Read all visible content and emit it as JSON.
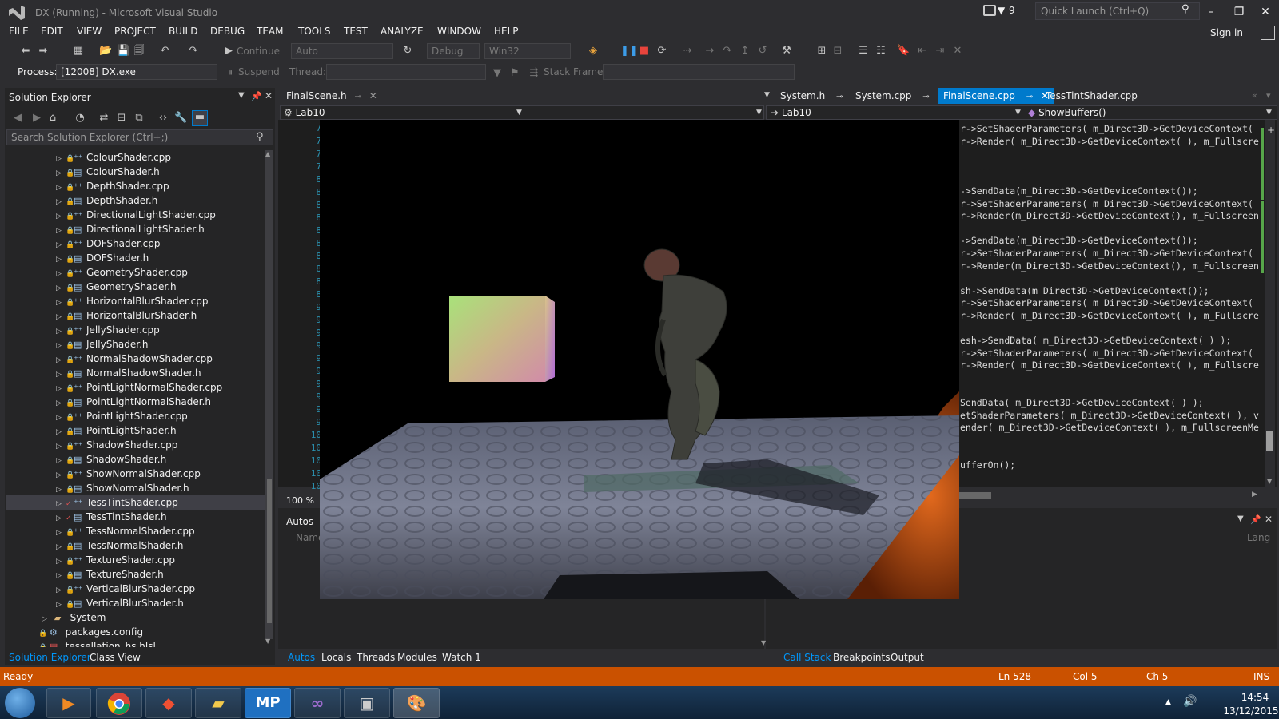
{
  "window": {
    "title": "DX (Running) - Microsoft Visual Studio",
    "notification_count": "9",
    "quick_launch_placeholder": "Quick Launch (Ctrl+Q)",
    "sign_in": "Sign in"
  },
  "menu": [
    "FILE",
    "EDIT",
    "VIEW",
    "PROJECT",
    "BUILD",
    "DEBUG",
    "TEAM",
    "TOOLS",
    "TEST",
    "ANALYZE",
    "WINDOW",
    "HELP"
  ],
  "toolbar": {
    "continue_label": "Continue",
    "auto_value": "Auto",
    "config_value": "Debug",
    "platform_value": "Win32",
    "process_label": "Process:",
    "process_value": "[12008] DX.exe",
    "suspend_label": "Suspend",
    "thread_label": "Thread:",
    "stack_frame_label": "Stack Frame:"
  },
  "solution_explorer": {
    "title": "Solution Explorer",
    "search_placeholder": "Search Solution Explorer (Ctrl+;)",
    "files": [
      {
        "name": "ColourShader.cpp",
        "type": "cpp"
      },
      {
        "name": "ColourShader.h",
        "type": "h"
      },
      {
        "name": "DepthShader.cpp",
        "type": "cpp"
      },
      {
        "name": "DepthShader.h",
        "type": "h"
      },
      {
        "name": "DirectionalLightShader.cpp",
        "type": "cpp"
      },
      {
        "name": "DirectionalLightShader.h",
        "type": "h"
      },
      {
        "name": "DOFShader.cpp",
        "type": "cpp"
      },
      {
        "name": "DOFShader.h",
        "type": "h"
      },
      {
        "name": "GeometryShader.cpp",
        "type": "cpp"
      },
      {
        "name": "GeometryShader.h",
        "type": "h"
      },
      {
        "name": "HorizontalBlurShader.cpp",
        "type": "cpp"
      },
      {
        "name": "HorizontalBlurShader.h",
        "type": "h"
      },
      {
        "name": "JellyShader.cpp",
        "type": "cpp"
      },
      {
        "name": "JellyShader.h",
        "type": "h"
      },
      {
        "name": "NormalShadowShader.cpp",
        "type": "cpp"
      },
      {
        "name": "NormalShadowShader.h",
        "type": "h"
      },
      {
        "name": "PointLightNormalShader.cpp",
        "type": "cpp"
      },
      {
        "name": "PointLightNormalShader.h",
        "type": "h"
      },
      {
        "name": "PointLightShader.cpp",
        "type": "cpp"
      },
      {
        "name": "PointLightShader.h",
        "type": "h"
      },
      {
        "name": "ShadowShader.cpp",
        "type": "cpp"
      },
      {
        "name": "ShadowShader.h",
        "type": "h"
      },
      {
        "name": "ShowNormalShader.cpp",
        "type": "cpp"
      },
      {
        "name": "ShowNormalShader.h",
        "type": "h"
      },
      {
        "name": "TessTintShader.cpp",
        "type": "cpp"
      },
      {
        "name": "TessTintShader.h",
        "type": "h"
      },
      {
        "name": "TessNormalShader.cpp",
        "type": "cpp"
      },
      {
        "name": "TessNormalShader.h",
        "type": "h"
      },
      {
        "name": "TextureShader.cpp",
        "type": "cpp"
      },
      {
        "name": "TextureShader.h",
        "type": "h"
      },
      {
        "name": "VerticalBlurShader.cpp",
        "type": "cpp"
      },
      {
        "name": "VerticalBlurShader.h",
        "type": "h"
      }
    ],
    "folder_system": "System",
    "packages_config": "packages.config",
    "tessellation_file": "tessellation_hs.hlsl",
    "tab_solution_explorer": "Solution Explorer",
    "tab_class_view": "Class View"
  },
  "editor_left": {
    "tab": "FinalScene.h",
    "nav_scope": "Lab10",
    "line_numbers": [
      "7",
      "7",
      "7",
      "7",
      "8",
      "8",
      "8",
      "8",
      "8",
      "8",
      "8",
      "8",
      "8",
      "8",
      "9",
      "9",
      "9",
      "9",
      "9",
      "9",
      "9",
      "9",
      "9",
      "9",
      "10",
      "10",
      "10",
      "10",
      "10"
    ],
    "zoom": "100 %"
  },
  "editor_right": {
    "tabs": [
      {
        "label": "System.h",
        "active": false
      },
      {
        "label": "System.cpp",
        "active": false
      },
      {
        "label": "FinalScene.cpp",
        "active": true
      },
      {
        "label": "TessTintShader.cpp",
        "active": false
      }
    ],
    "nav_scope": "Lab10",
    "nav_member": "ShowBuffers()",
    "code_lines": [
      "r->SetShaderParameters( m_Direct3D->GetDeviceContext(",
      "r->Render( m_Direct3D->GetDeviceContext( ), m_Fullscre",
      "",
      "",
      "",
      "->SendData(m_Direct3D->GetDeviceContext());",
      "r->SetShaderParameters( m_Direct3D->GetDeviceContext(",
      "r->Render(m_Direct3D->GetDeviceContext(), m_Fullscreen",
      "",
      "->SendData(m_Direct3D->GetDeviceContext());",
      "r->SetShaderParameters( m_Direct3D->GetDeviceContext(",
      "r->Render(m_Direct3D->GetDeviceContext(), m_Fullscreen",
      "",
      "sh->SendData(m_Direct3D->GetDeviceContext());",
      "r->SetShaderParameters( m_Direct3D->GetDeviceContext(",
      "r->Render( m_Direct3D->GetDeviceContext( ), m_Fullscre",
      "",
      "esh->SendData( m_Direct3D->GetDeviceContext( ) );",
      "r->SetShaderParameters( m_Direct3D->GetDeviceContext(",
      "r->Render( m_Direct3D->GetDeviceContext( ), m_Fullscre",
      "",
      "",
      "SendData( m_Direct3D->GetDeviceContext( ) );",
      "etShaderParameters( m_Direct3D->GetDeviceContext( ), v",
      "ender( m_Direct3D->GetDeviceContext( ), m_FullscreenMe",
      "",
      "",
      "ufferOn();"
    ]
  },
  "autos_panel": {
    "title": "Autos",
    "col_name": "Name",
    "tabs": [
      {
        "label": "Autos",
        "active": true
      },
      {
        "label": "Locals",
        "active": false
      },
      {
        "label": "Threads",
        "active": false
      },
      {
        "label": "Modules",
        "active": false
      },
      {
        "label": "Watch 1",
        "active": false
      }
    ]
  },
  "callstack_panel": {
    "col_lang": "Lang",
    "tabs": [
      {
        "label": "Call Stack",
        "active": true
      },
      {
        "label": "Breakpoints",
        "active": false
      },
      {
        "label": "Output",
        "active": false
      }
    ]
  },
  "status_bar": {
    "state": "Ready",
    "line": "Ln 528",
    "col": "Col 5",
    "ch": "Ch 5",
    "mode": "INS"
  },
  "taskbar": {
    "apps": [
      "start-orb",
      "media-player",
      "chrome",
      "git-client",
      "file-explorer",
      "MP",
      "visual-studio",
      "dx-window",
      "paint"
    ],
    "mp_label": "MP",
    "time": "14:54",
    "date": "13/12/2015"
  },
  "colors": {
    "status_bar": "#ca5100",
    "accent": "#007acc",
    "vs_purple": "#68217a"
  }
}
